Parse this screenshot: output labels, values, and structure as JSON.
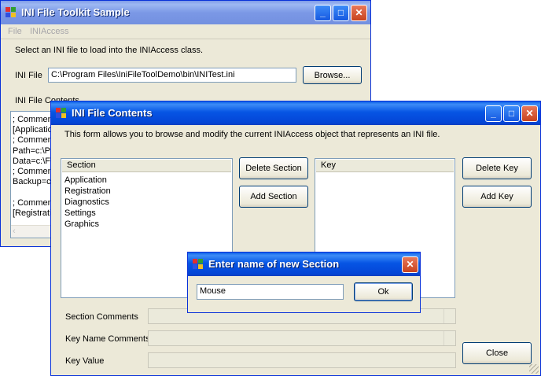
{
  "main_window": {
    "title": "INI File Toolkit Sample",
    "menu": [
      "File",
      "INIAccess"
    ],
    "instructions": "Select an INI file to load into the INIAccess class.",
    "ini_file_label": "INI File",
    "ini_file_value": "C:\\Program Files\\IniFileToolDemo\\bin\\INITest.ini",
    "browse_label": "Browse...",
    "contents_label": "INI File Contents",
    "contents_lines": [
      "; Comment",
      "[Applicatio",
      "; Comment",
      "Path=c:\\P",
      "Data=c:\\F",
      "; Comment",
      "Backup=c",
      "",
      "; Comment",
      "[Registrati"
    ]
  },
  "contents_window": {
    "title": "INI File Contents",
    "description": "This form allows you to browse and modify the current INIAccess object that represents an INI file.",
    "section_header": "Section",
    "sections": [
      "Application",
      "Registration",
      "Diagnostics",
      "Settings",
      "Graphics"
    ],
    "delete_section_label": "Delete Section",
    "add_section_label": "Add Section",
    "key_header": "Key",
    "delete_key_label": "Delete Key",
    "add_key_label": "Add Key",
    "section_comments_label": "Section Comments",
    "key_name_comments_label": "Key Name Comments",
    "key_value_label": "Key Value",
    "close_label": "Close"
  },
  "dialog": {
    "title": "Enter name of new Section",
    "input_value": "Mouse",
    "ok_label": "Ok"
  },
  "colors": {
    "titlebar_active": "#0655e4",
    "window_bg": "#ece9d8",
    "close_btn": "#c8431e"
  }
}
